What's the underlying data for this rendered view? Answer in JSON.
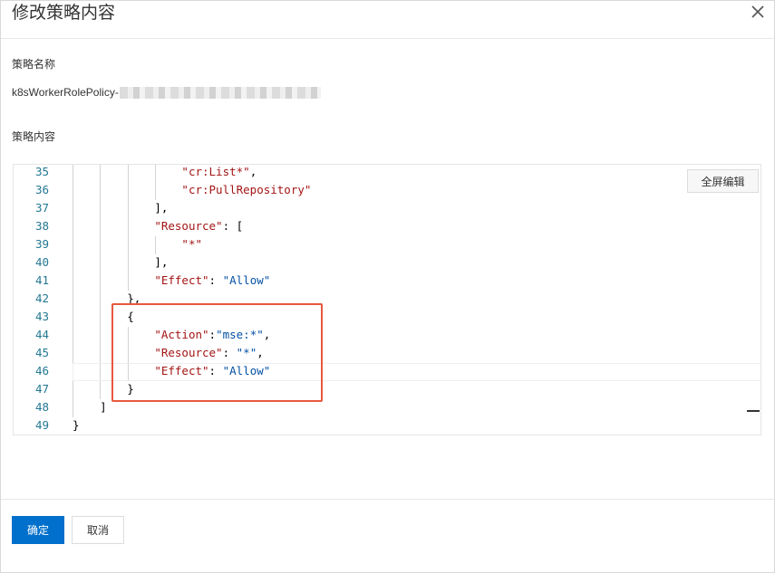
{
  "dialog": {
    "title": "修改策略内容",
    "name_label": "策略名称",
    "name_value": "k8sWorkerRolePolicy-",
    "content_label": "策略内容",
    "fullscreen_label": "全屏编辑",
    "ok_label": "确定",
    "cancel_label": "取消"
  },
  "editor": {
    "lines": [
      {
        "num": "35",
        "indent": "                ",
        "parts": [
          {
            "t": "\"cr:List*\"",
            "c": "s"
          },
          {
            "t": ",",
            "c": "p"
          }
        ]
      },
      {
        "num": "36",
        "indent": "                ",
        "parts": [
          {
            "t": "\"cr:PullRepository\"",
            "c": "s"
          }
        ]
      },
      {
        "num": "37",
        "indent": "            ",
        "parts": [
          {
            "t": "],",
            "c": "p"
          }
        ]
      },
      {
        "num": "38",
        "indent": "            ",
        "parts": [
          {
            "t": "\"Resource\"",
            "c": "s"
          },
          {
            "t": ": [",
            "c": "p"
          }
        ]
      },
      {
        "num": "39",
        "indent": "                ",
        "parts": [
          {
            "t": "\"*\"",
            "c": "s"
          }
        ]
      },
      {
        "num": "40",
        "indent": "            ",
        "parts": [
          {
            "t": "],",
            "c": "p"
          }
        ]
      },
      {
        "num": "41",
        "indent": "            ",
        "parts": [
          {
            "t": "\"Effect\"",
            "c": "s"
          },
          {
            "t": ": ",
            "c": "p"
          },
          {
            "t": "\"Allow\"",
            "c": "v"
          }
        ]
      },
      {
        "num": "42",
        "indent": "        ",
        "parts": [
          {
            "t": "},",
            "c": "p"
          }
        ]
      },
      {
        "num": "43",
        "indent": "        ",
        "parts": [
          {
            "t": "{",
            "c": "p"
          }
        ]
      },
      {
        "num": "44",
        "indent": "            ",
        "parts": [
          {
            "t": "\"Action\"",
            "c": "s"
          },
          {
            "t": ":",
            "c": "p"
          },
          {
            "t": "\"mse:*\"",
            "c": "v"
          },
          {
            "t": ",",
            "c": "p"
          }
        ]
      },
      {
        "num": "45",
        "indent": "            ",
        "parts": [
          {
            "t": "\"Resource\"",
            "c": "s"
          },
          {
            "t": ": ",
            "c": "p"
          },
          {
            "t": "\"*\"",
            "c": "v"
          },
          {
            "t": ",",
            "c": "p"
          }
        ]
      },
      {
        "num": "46",
        "indent": "            ",
        "parts": [
          {
            "t": "\"Effect\"",
            "c": "s"
          },
          {
            "t": ": ",
            "c": "p"
          },
          {
            "t": "\"Allow\"",
            "c": "v"
          }
        ]
      },
      {
        "num": "47",
        "indent": "        ",
        "parts": [
          {
            "t": "}",
            "c": "p"
          }
        ]
      },
      {
        "num": "48",
        "indent": "    ",
        "parts": [
          {
            "t": "]",
            "c": "p"
          }
        ]
      },
      {
        "num": "49",
        "indent": "",
        "parts": [
          {
            "t": "}",
            "c": "p"
          }
        ]
      }
    ]
  },
  "colors": {
    "primary": "#0070cc",
    "highlight_border": "#e8583d",
    "line_number": "#237893",
    "string_key": "#a31515",
    "string_value": "#0451a5"
  }
}
